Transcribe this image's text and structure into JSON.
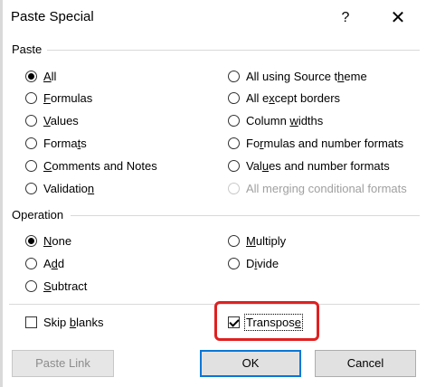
{
  "window": {
    "title": "Paste Special",
    "help": "?"
  },
  "paste": {
    "label": "Paste",
    "left": [
      {
        "pre": "",
        "key": "A",
        "post": "ll",
        "checked": true
      },
      {
        "pre": "",
        "key": "F",
        "post": "ormulas",
        "checked": false
      },
      {
        "pre": "",
        "key": "V",
        "post": "alues",
        "checked": false
      },
      {
        "pre": "Forma",
        "key": "t",
        "post": "s",
        "checked": false
      },
      {
        "pre": "",
        "key": "C",
        "post": "omments and Notes",
        "checked": false
      },
      {
        "pre": "Validatio",
        "key": "n",
        "post": "",
        "checked": false
      }
    ],
    "right": [
      {
        "pre": "All using Source t",
        "key": "h",
        "post": "eme",
        "checked": false,
        "disabled": false
      },
      {
        "pre": "All e",
        "key": "x",
        "post": "cept borders",
        "checked": false,
        "disabled": false
      },
      {
        "pre": "Column ",
        "key": "w",
        "post": "idths",
        "checked": false,
        "disabled": false
      },
      {
        "pre": "Fo",
        "key": "r",
        "post": "mulas and number formats",
        "checked": false,
        "disabled": false
      },
      {
        "pre": "Val",
        "key": "u",
        "post": "es and number formats",
        "checked": false,
        "disabled": false
      },
      {
        "pre": "All merging conditional formats",
        "key": "",
        "post": "",
        "checked": false,
        "disabled": true
      }
    ]
  },
  "operation": {
    "label": "Operation",
    "left": [
      {
        "pre": "",
        "key": "N",
        "post": "one",
        "checked": true
      },
      {
        "pre": "A",
        "key": "d",
        "post": "d",
        "checked": false
      },
      {
        "pre": "",
        "key": "S",
        "post": "ubtract",
        "checked": false
      }
    ],
    "right": [
      {
        "pre": "",
        "key": "M",
        "post": "ultiply",
        "checked": false
      },
      {
        "pre": "D",
        "key": "i",
        "post": "vide",
        "checked": false
      }
    ]
  },
  "options": {
    "skip_blanks": {
      "pre": "Skip ",
      "key": "b",
      "post": "lanks",
      "checked": false
    },
    "transpose": {
      "pre": "Transpos",
      "key": "e",
      "post": "",
      "checked": true
    }
  },
  "buttons": {
    "paste_link": "Paste Link",
    "ok": "OK",
    "cancel": "Cancel"
  },
  "colors": {
    "highlight": "#e02020",
    "default_button_border": "#0078d7"
  }
}
